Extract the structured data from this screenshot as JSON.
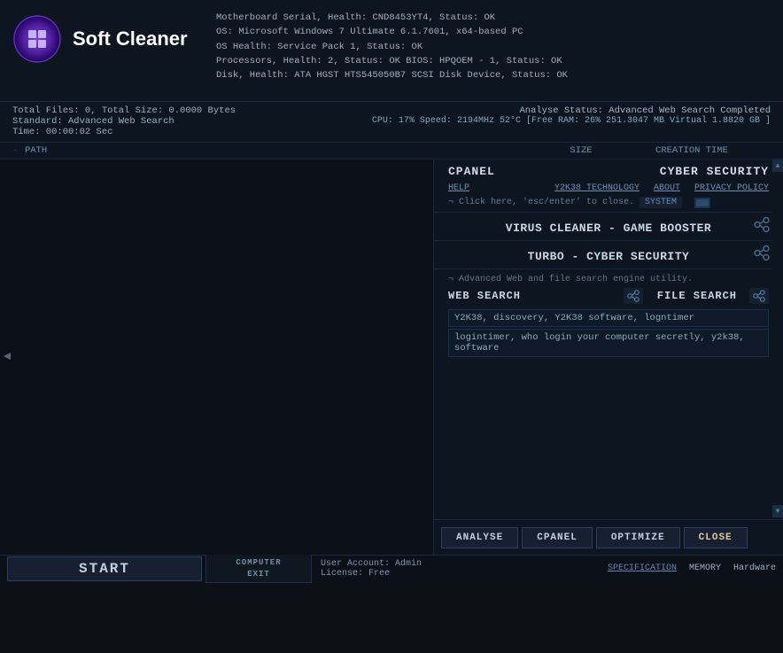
{
  "app": {
    "title": "Soft Cleaner",
    "logo_unicode": "⊞"
  },
  "sysinfo": {
    "line1": "Motherboard Serial, Health: CND8453YT4, Status: OK",
    "line2": "OS: Microsoft Windows 7 Ultimate 6.1.7601, x64-based PC",
    "line3": "OS Health: Service Pack 1, Status: OK",
    "line4": "Processors, Health: 2, Status: OK    BIOS: HPQOEM - 1, Status: OK",
    "line5": "Disk, Health: ATA HGST HTS545050B7 SCSI Disk Device, Status: OK"
  },
  "stats": {
    "total_files": "Total Files: 0, Total Size: 0.0000 Bytes",
    "standard": "Standard: Advanced Web Search",
    "time": "Time: 00:00:02 Sec",
    "analyse_status": "Analyse Status: Advanced Web Search Completed",
    "cpu_info": "CPU: 17% Speed: 2194MHz 52°C [Free RAM: 26% 251.3047 MB Virtual 1.8820 GB ]"
  },
  "columns": {
    "path": "PATH",
    "size": "SIZE",
    "creation_time": "CREATION TIME"
  },
  "right_panel": {
    "cpanel_label": "CPANEL",
    "cyber_label": "CYBER SECURITY",
    "help_link": "HELP",
    "y2k38_link": "Y2K38 TECHNOLOGY",
    "about_link": "ABOUT",
    "privacy_link": "PRIVACY POLICY",
    "hint_text": "¬ Click here, 'esc/enter' to close.",
    "system_label": "SYSTEM",
    "virus_title": "VIRUS CLEANER - GAME BOOSTER",
    "turbo_title": "TURBO - CYBER SECURITY",
    "web_hint": "¬ Advanced Web and file search engine utility.",
    "web_search_label": "WEB SEARCH",
    "file_search_label": "FILE SEARCH",
    "search_result1": "Y2K38, discovery, Y2K38 software, logntimer",
    "search_result2": "logintimer, who login your computer secretly, y2k38, software"
  },
  "actions": {
    "analyse_label": "ANALYSE",
    "cpanel_label": "CPANEL",
    "optimize_label": "OPTIMIZE",
    "close_label": "CLOSE"
  },
  "statusbar": {
    "start_label": "START",
    "computer_label": "COMPUTER",
    "exit_label": "EXIT",
    "user_account": "User Account: Admin",
    "license": "License: Free",
    "specification_label": "SPECIFICATION",
    "memory_label": "MEMORY",
    "hardware_label": "Hardware"
  }
}
